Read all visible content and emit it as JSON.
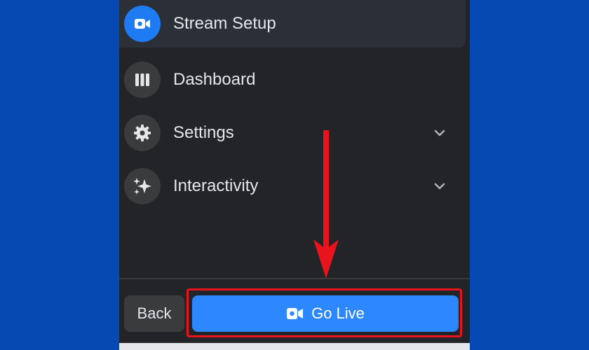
{
  "menu": {
    "items": [
      {
        "label": "Stream Setup",
        "icon": "video-camera-icon",
        "active": true
      },
      {
        "label": "Dashboard",
        "icon": "dashboard-columns-icon",
        "active": false
      },
      {
        "label": "Settings",
        "icon": "gear-icon",
        "active": false,
        "expandable": true
      },
      {
        "label": "Interactivity",
        "icon": "sparkle-icon",
        "active": false,
        "expandable": true
      }
    ]
  },
  "footer": {
    "back_label": "Back",
    "go_live_label": "Go Live"
  },
  "colors": {
    "background": "#0649b3",
    "panel": "#232427",
    "accent": "#2d88ff",
    "annotation": "#e8131c"
  }
}
